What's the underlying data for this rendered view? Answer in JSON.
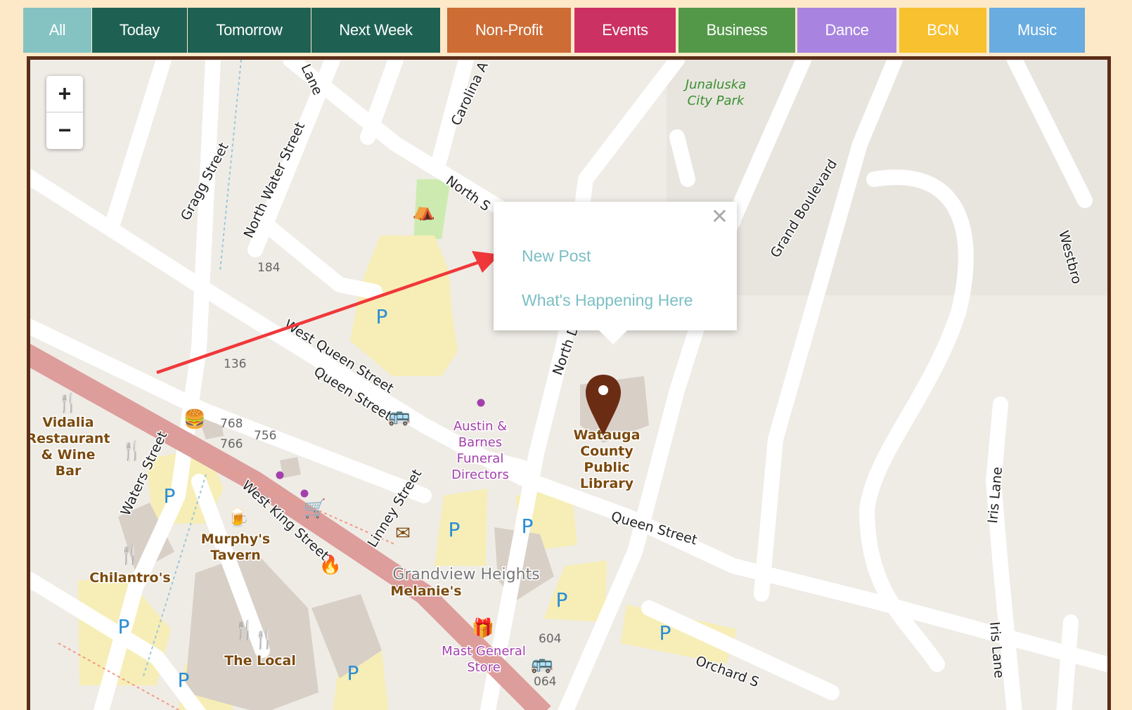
{
  "filters": [
    {
      "label": "All",
      "color": "#84c3c2"
    },
    {
      "label": "Today",
      "color": "#1e6153"
    },
    {
      "label": "Tomorrow",
      "color": "#1e6153"
    },
    {
      "label": "Next Week",
      "color": "#1e6153"
    },
    {
      "label": "Non-Profit",
      "color": "#cd6c35"
    },
    {
      "label": "Events",
      "color": "#cc3163"
    },
    {
      "label": "Business",
      "color": "#539849"
    },
    {
      "label": "Dance",
      "color": "#a884e0"
    },
    {
      "label": "BCN",
      "color": "#f7c12f"
    },
    {
      "label": "Music",
      "color": "#68ace0"
    }
  ],
  "zoom": {
    "in_label": "+",
    "out_label": "−"
  },
  "popup": {
    "close_label": "✕",
    "new_post": "New Post",
    "whats_happening": "What's Happening Here"
  },
  "map": {
    "streets": {
      "carolina": "Carolina A",
      "lane_top": "Lane",
      "gragg": "Gragg Street",
      "north_water": "North Water Street",
      "north_top": "North S",
      "west_queen": "West Queen Street",
      "queen1": "Queen Street",
      "north_de": "North De",
      "grand_blvd": "Grand Boulevard",
      "westbro": "Westbro",
      "waters": "Waters Street",
      "west_king": "West King Street",
      "linney": "Linney Street",
      "queen2": "Queen Street",
      "iris1": "Iris Lane",
      "iris2": "Iris Lane",
      "orchard": "Orchard S"
    },
    "places": {
      "park": [
        "Junaluska",
        "City Park"
      ],
      "library": [
        "Watauga",
        "County",
        "Public",
        "Library"
      ],
      "austin": [
        "Austin &",
        "Barnes",
        "Funeral",
        "Directors"
      ],
      "vidalia": [
        "Vidalia",
        "Restaurant",
        "& Wine",
        "Bar"
      ],
      "murphys": [
        "Murphy's",
        "Tavern"
      ],
      "chilantros": "Chilantro's",
      "the_local": "The Local",
      "grandview": "Grandview Heights",
      "melanies": "Melanie's",
      "mast": [
        "Mast General",
        "Store"
      ]
    },
    "numbers": [
      "184",
      "136",
      "768",
      "766",
      "756",
      "604",
      "064"
    ],
    "parking_label": "P"
  },
  "colors": {
    "map_bg": "#efece6",
    "road": "#ffffff",
    "king_street": "#dd9d9b",
    "parking": "#f6eeb6",
    "building": "#d8cfc7",
    "park": "#cdebb0",
    "marker": "#6b2c14",
    "arrow": "#f0383a",
    "poi_brown": "#7b4a0d",
    "poi_purple": "#a33fad",
    "parking_text": "#2b8dd6"
  }
}
